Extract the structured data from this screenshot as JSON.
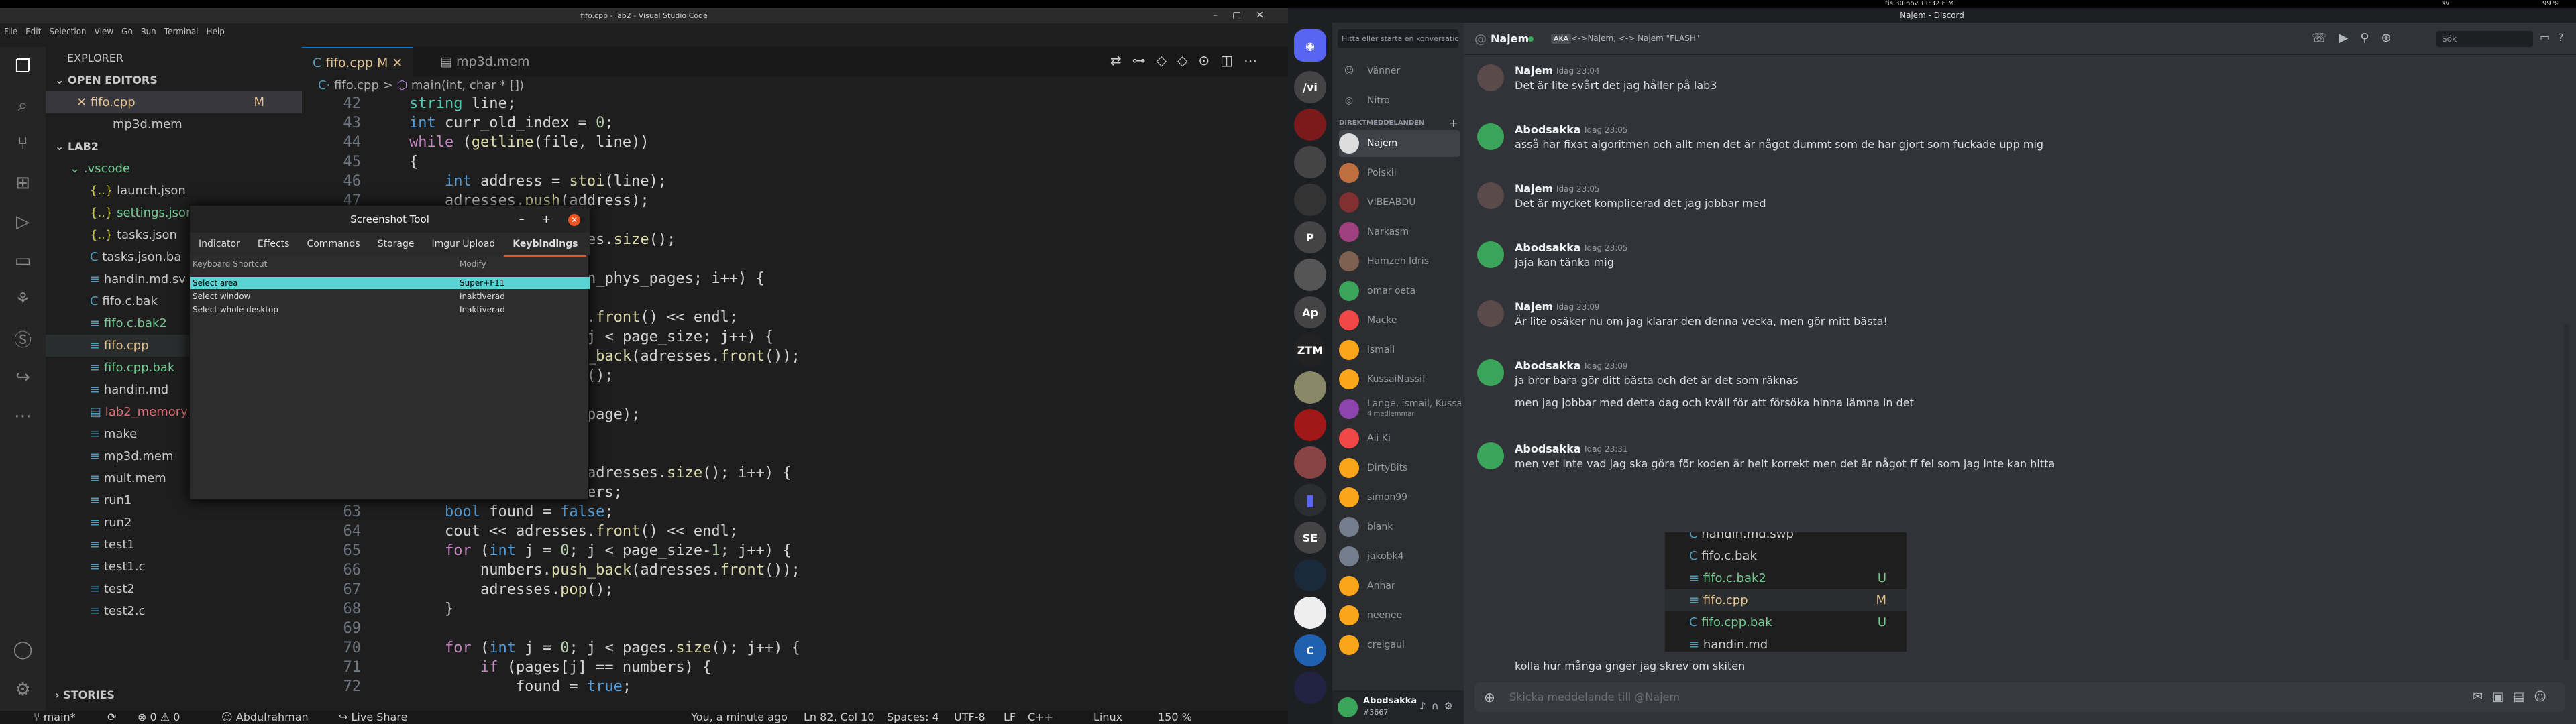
{
  "system": {
    "datetime": "tis 30 nov  11:32 E.M.",
    "lang": "sv",
    "battery": "99 %"
  },
  "vscode": {
    "title": "fifo.cpp - lab2 - Visual Studio Code",
    "menu": [
      "File",
      "Edit",
      "Selection",
      "View",
      "Go",
      "Run",
      "Terminal",
      "Help"
    ],
    "explorer": {
      "header": "EXPLORER",
      "open_editors": "OPEN EDITORS",
      "open_files": [
        {
          "name": "fifo.cpp",
          "badge": "M"
        },
        {
          "name": "mp3d.mem",
          "badge": ""
        }
      ],
      "folder": "LAB2",
      "vscode_folder": ".vscode",
      "vscode_files": [
        "launch.json",
        "settings.json",
        "tasks.json"
      ],
      "files": [
        "tasks.json.ba",
        "handin.md.sv",
        "fifo.c.bak",
        "fifo.c.bak2",
        "fifo.cpp",
        "fifo.cpp.bak",
        "handin.md",
        "lab2_memory_",
        "make",
        "mp3d.mem",
        "mult.mem",
        "run1",
        "run2",
        "test1",
        "test1.c",
        "test2",
        "test2.c"
      ],
      "stories": "STORIES"
    },
    "tabs": [
      {
        "label": "fifo.cpp",
        "badge": "M"
      },
      {
        "label": "mp3d.mem"
      }
    ],
    "breadcrumb": {
      "file": "fifo.cpp",
      "sep": ">",
      "func": "main(int, char * [])"
    },
    "code_lines": [
      {
        "n": "42",
        "t": "string line;"
      },
      {
        "n": "43",
        "t": "int curr_old_index = 0;"
      },
      {
        "n": "44",
        "t": "while (getline(file, line))"
      },
      {
        "n": "45",
        "t": "{"
      },
      {
        "n": "46",
        "t": "    int address = stoi(line);"
      },
      {
        "n": "47",
        "t": "    adresses.push(address);"
      },
      {
        "n": "48",
        "t": "}"
      },
      {
        "n": "49",
        "t": "int n_pages = adresses.size();"
      },
      {
        "n": "50",
        "t": ""
      },
      {
        "n": "51",
        "t": "for (int i = 0; i < n_phys_pages; i++) {"
      },
      {
        "n": "52",
        "t": ""
      },
      {
        "n": "53",
        "t": "    cout << adresses.front() << endl;"
      },
      {
        "n": "54",
        "t": "    for (int j = 0; j < page_size; j++) {"
      },
      {
        "n": "55",
        "t": "        numbers.push_back(adresses.front());"
      },
      {
        "n": "56",
        "t": "        adresses.pop();"
      },
      {
        "n": "57",
        "t": "    }"
      },
      {
        "n": "58",
        "t": "    pages.push_back(page);"
      },
      {
        "n": "59",
        "t": "}"
      },
      {
        "n": "60",
        "t": ""
      },
      {
        "n": "61",
        "t": "for (int i = 0; i < adresses.size(); i++) {"
      },
      {
        "n": "62",
        "t": "    vector<int> numbers;"
      },
      {
        "n": "63",
        "t": "    bool found = false;"
      },
      {
        "n": "64",
        "t": "    cout << adresses.front() << endl;"
      },
      {
        "n": "65",
        "t": "    for (int j = 0; j < page_size-1; j++) {"
      },
      {
        "n": "66",
        "t": "        numbers.push_back(adresses.front());"
      },
      {
        "n": "67",
        "t": "        adresses.pop();"
      },
      {
        "n": "68",
        "t": "    }"
      },
      {
        "n": "69",
        "t": ""
      },
      {
        "n": "70",
        "t": "    for (int j = 0; j < pages.size(); j++) {"
      },
      {
        "n": "71",
        "t": "        if (pages[j] == numbers) {"
      },
      {
        "n": "72",
        "t": "            found = true;"
      }
    ],
    "status": {
      "branch": "main*",
      "sync": "⟳",
      "errors": "⊗ 0 ⚠ 0",
      "user": "Abdulrahman",
      "live": "Live Share",
      "blame": "You, a minute ago",
      "pos": "Ln 82, Col 10",
      "spaces": "Spaces: 4",
      "enc": "UTF-8",
      "eol": "LF",
      "lang": "C++",
      "os": "Linux",
      "zoom": "150 %"
    }
  },
  "screenshot_tool": {
    "title": "Screenshot Tool",
    "tabs": [
      "Indicator",
      "Effects",
      "Commands",
      "Storage",
      "Imgur Upload",
      "Keybindings"
    ],
    "active_tab": "Keybindings",
    "col_shortcut": "Keyboard Shortcut",
    "col_modify": "Modify",
    "rows": [
      {
        "action": "Select area",
        "key": "Super+F11"
      },
      {
        "action": "Select window",
        "key": "Inaktiverad"
      },
      {
        "action": "Select whole desktop",
        "key": "Inaktiverad"
      }
    ]
  },
  "discord": {
    "title": "Najem - Discord",
    "search_placeholder": "Hitta eller starta en konversation",
    "friends": "Vänner",
    "nitro": "Nitro",
    "dm_header": "DIREKTMEDDELANDEN",
    "dms": [
      {
        "name": "Najem",
        "color": "#ddd"
      },
      {
        "name": "Polskii",
        "color": "#c07040"
      },
      {
        "name": "VIBEABDU",
        "color": "#803030"
      },
      {
        "name": "Narkasm",
        "color": "#a04080"
      },
      {
        "name": "Hamzeh Idris",
        "color": "#806050"
      },
      {
        "name": "omar oeta",
        "color": "#3ba55c"
      },
      {
        "name": "Macke",
        "color": "#f04747"
      },
      {
        "name": "ismail",
        "color": "#faa61a"
      },
      {
        "name": "KussaiNassif",
        "color": "#faa61a"
      },
      {
        "name": "Lange, ismail, Kussai...",
        "color": "#8e44ad"
      },
      {
        "name": "Ali Ki",
        "color": "#f04747"
      },
      {
        "name": "DirtyBits",
        "color": "#faa61a"
      },
      {
        "name": "simon99",
        "color": "#faa61a"
      },
      {
        "name": "blank",
        "color": "#747f8d"
      },
      {
        "name": "jakobk4",
        "color": "#747f8d"
      },
      {
        "name": "Anhar",
        "color": "#faa61a"
      },
      {
        "name": "neenee",
        "color": "#faa61a"
      },
      {
        "name": "creigaul",
        "color": "#faa61a"
      }
    ],
    "group_sub": "4 medlemmar",
    "me": {
      "name": "Abodsakka",
      "tag": "#3667"
    },
    "chat_user": "Najem",
    "aka_label": "AKA",
    "aka_value": "<->Najem, <-> Najem \"FLASH\"",
    "header_search": "Sök",
    "messages": [
      {
        "user": "Najem",
        "time": "Idag 23:04",
        "lines": [
          "Det är lite svårt det jag håller på lab3"
        ]
      },
      {
        "user": "Abodsakka",
        "time": "Idag 23:05",
        "lines": [
          "asså har fixat algoritmen och allt men det är något dummt som de har gjort som fuckade upp mig"
        ]
      },
      {
        "user": "Najem",
        "time": "Idag 23:05",
        "lines": [
          "Det är mycket komplicerad det jag jobbar med"
        ]
      },
      {
        "user": "Abodsakka",
        "time": "Idag 23:05",
        "lines": [
          "jaja kan tänka mig"
        ]
      },
      {
        "user": "Najem",
        "time": "Idag 23:09",
        "lines": [
          "Är lite osäker nu om jag klarar den denna vecka, men gör mitt bästa!"
        ]
      },
      {
        "user": "Abodsakka",
        "time": "Idag 23:09",
        "lines": [
          "ja bror bara gör ditt bästa och det är det som räknas",
          "men jag jobbar med detta dag och kväll för att försöka hinna lämna in det"
        ]
      },
      {
        "user": "Abodsakka",
        "time": "Idag 23:31",
        "lines": [
          "men vet inte vad jag ska göra för koden är helt korrekt men det är något ff fel som jag inte kan hitta"
        ]
      }
    ],
    "embed_files": [
      {
        "name": "handin.md.swp",
        "badge": ""
      },
      {
        "name": "fifo.c.bak",
        "badge": ""
      },
      {
        "name": "fifo.c.bak2",
        "badge": "U"
      },
      {
        "name": "fifo.cpp",
        "badge": "M"
      },
      {
        "name": "fifo.cpp.bak",
        "badge": "U"
      },
      {
        "name": "handin.md",
        "badge": ""
      }
    ],
    "last_message": "kolla hur många gnger jag skrev om skiten",
    "composer_placeholder": "Skicka meddelande till @Najem"
  }
}
